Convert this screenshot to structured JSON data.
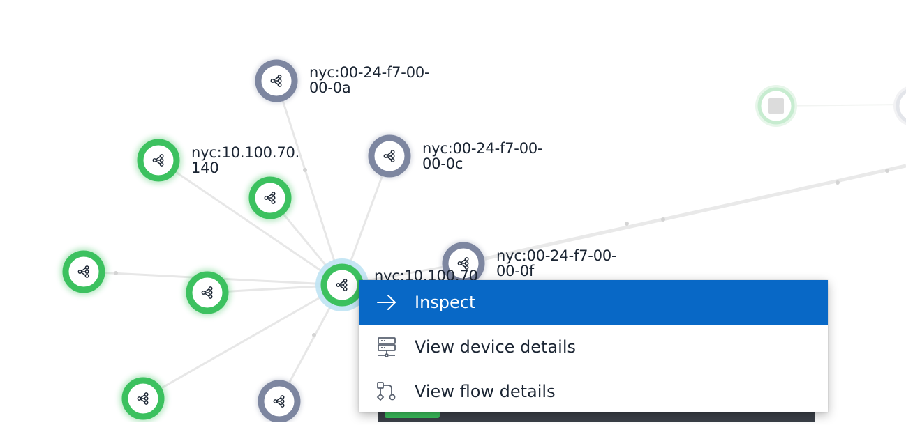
{
  "topology": {
    "node_labels": {
      "n_0a": "nyc:00-24-f7-00-\n00-0a",
      "n_140": "nyc:10.100.70.\n140",
      "n_0c": "nyc:00-24-f7-00-\n00-0c",
      "n_0f": "nyc:00-24-f7-00-\n00-0f",
      "n_center": "nyc:10.100.70"
    },
    "colors": {
      "green_ring": "#3cc15f",
      "gray_ring": "#7d86a0",
      "selected_halo": "#bfe3f3",
      "edge": "#e6e6e6"
    }
  },
  "context_menu": {
    "items": [
      {
        "label": "Inspect",
        "icon": "arrow-right-icon",
        "active": true
      },
      {
        "label": "View device details",
        "icon": "device-details-icon",
        "active": false
      },
      {
        "label": "View flow details",
        "icon": "flow-details-icon",
        "active": false
      }
    ],
    "accent": "#0868c6"
  }
}
